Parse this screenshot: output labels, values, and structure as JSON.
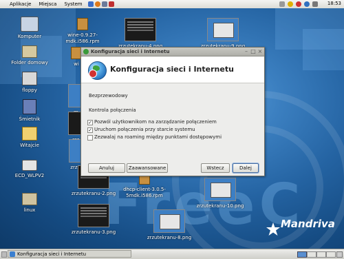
{
  "top_panel": {
    "menus": [
      "Aplikacje",
      "Miejsca",
      "System"
    ],
    "clock": "18:53"
  },
  "desktop": {
    "icons": [
      {
        "label": "Komputer"
      },
      {
        "label": "Folder domowy"
      },
      {
        "label": "floppy"
      },
      {
        "label": "Śmietnik"
      },
      {
        "label": "Witajcie"
      },
      {
        "label": "ECD_WLPV2"
      },
      {
        "label": "linux"
      }
    ],
    "files": {
      "wine": "wine-0.9.27-mdk.i586.rpm",
      "zrzut4": "zrzutekranu-4.png",
      "zrzut9": "zrzutekranu-9.png",
      "zrzut2": "zrzutekranu-2.png",
      "dhcp": "dhcp-client-3.0.5-5mdk.i586.rpm",
      "zrzut10": "zrzutekranu-10.png",
      "zrzut3": "zrzutekranu-3.png",
      "zrzut8": "zrzutekranu-8.png",
      "partial_wi": "wi",
      "partial_zr": "zr",
      "partial_zrz": "zrz",
      "partial_zrzut": "zrzut"
    },
    "wallpaper_text": "FreeC",
    "logo_text": "Mandriva"
  },
  "dialog": {
    "window_title": "Konfiguracja sieci i Internetu",
    "heading": "Konfiguracja sieci i Internetu",
    "section1": "Bezprzewodowy",
    "section2": "Kontrola połączenia",
    "options": [
      {
        "label": "Pozwól użytkownikom na zarządzanie połączeniem",
        "checked": true
      },
      {
        "label": "Uruchom połączenia przy starcie systemu",
        "checked": true
      },
      {
        "label": "Zezwalaj na roaming między punktami dostępowymi",
        "checked": false
      }
    ],
    "buttons": {
      "cancel": "Anuluj",
      "advanced": "Zaawansowane",
      "back": "Wstecz",
      "next": "Dalej"
    }
  },
  "taskbar": {
    "task_label": "Konfiguracja sieci i Internetu"
  }
}
